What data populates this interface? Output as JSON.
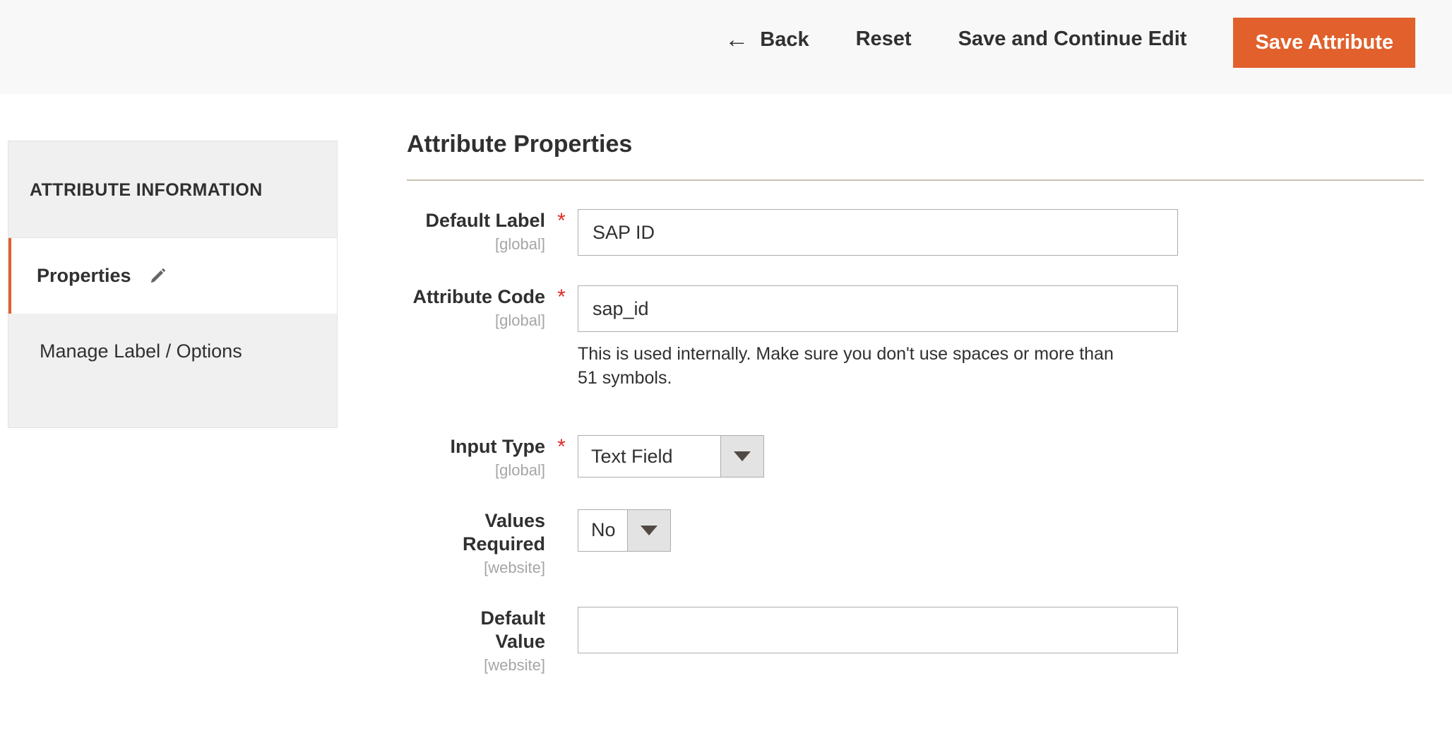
{
  "toolbar": {
    "back_label": "Back",
    "back_icon": "arrow-left-icon",
    "reset_label": "Reset",
    "save_continue_label": "Save and Continue Edit",
    "save_attribute_label": "Save Attribute",
    "primary_color": "#e1602b"
  },
  "sidebar": {
    "title": "ATTRIBUTE INFORMATION",
    "items": [
      {
        "label": "Properties",
        "active": true,
        "icon": "pencil-icon"
      },
      {
        "label": "Manage Label / Options",
        "active": false
      }
    ],
    "active_accent_color": "#e1602b"
  },
  "main": {
    "section_title": "Attribute Properties",
    "required_marker": "*",
    "fields": {
      "default_label": {
        "label": "Default Label",
        "scope": "[global]",
        "required": "*",
        "value": "SAP ID"
      },
      "attribute_code": {
        "label": "Attribute Code",
        "scope": "[global]",
        "required": "*",
        "value": "sap_id",
        "note": "This is used internally. Make sure you don't use spaces or more than 51 symbols."
      },
      "input_type": {
        "label": "Input Type",
        "scope": "[global]",
        "required": "*",
        "value": "Text Field"
      },
      "values_required": {
        "label_line1": "Values",
        "label_line2": "Required",
        "scope": "[website]",
        "value": "No"
      },
      "default_value": {
        "label_line1": "Default",
        "label_line2": "Value",
        "scope": "[website]",
        "value": "",
        "placeholder": ""
      }
    }
  }
}
